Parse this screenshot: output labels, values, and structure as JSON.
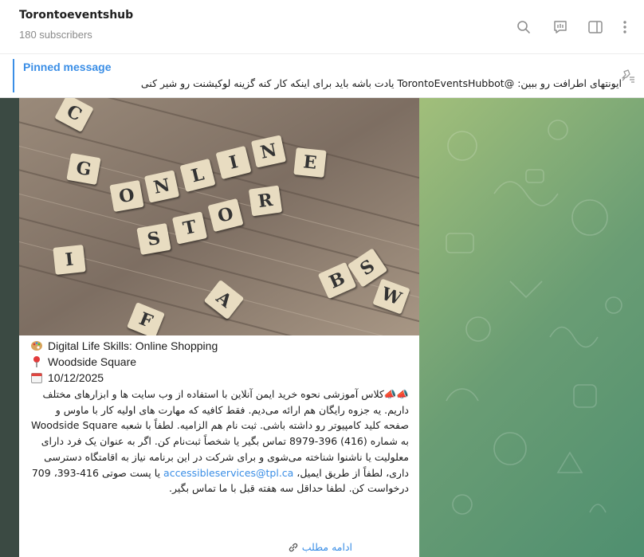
{
  "header": {
    "title": "Torontoeventshub",
    "subscribers": "180 subscribers",
    "icons": [
      "search-icon",
      "live-chat-icon",
      "sidebar-toggle-icon",
      "more-vertical-icon"
    ]
  },
  "pinned": {
    "title": "Pinned message",
    "text": "ایونتهای اطرافت رو ببین: @TorontoEventsHubbot یادت باشه باید برای اینکه کار کنه گزینه لوکیشنت رو شیر کنی",
    "icon": "pin-list-icon"
  },
  "post": {
    "image_tiles": [
      "C",
      "G",
      "O",
      "N",
      "L",
      "I",
      "N",
      "E",
      "S",
      "T",
      "O",
      "R",
      "B",
      "S",
      "W",
      "I",
      "A",
      "F"
    ],
    "event_title": "Digital Life Skills: Online Shopping",
    "location": "Woodside Square",
    "date": "10/12/2025",
    "body_prefix": "📣📣کلاس آموزشی نحوه خرید ایمن آنلاین با استفاده از وب سایت ها و ابزارهای مختلف داریم. یه جزوه رایگان هم ارائه می‌دیم. فقط کافیه که مهارت های اولیه کار با ماوس و صفحه کلید کامپیوتر رو داشته باشی. ثبت نام هم الزامیه. لطفاً با شعبه Woodside Square به شماره (416) 396-8979 تماس بگیر یا شخصاً ثبت‌نام کن. اگر به عنوان یک فرد دارای معلولیت یا ناشنوا شناخته می‌شوی و برای شرکت در این برنامه نیاز به اقامتگاه دسترسی داری، لطفاً از طریق ایمیل، ",
    "email": "accessibleservices@tpl.ca",
    "body_suffix": " یا پست صوتی 416-393، 709 درخواست کن. لطفا حداقل سه هفته قبل با ما تماس بگیر.",
    "read_more": "ادامه مطلب"
  },
  "colors": {
    "accent": "#3a8ee6",
    "chat_bg_start": "#8bb27a",
    "chat_bg_end": "#4f8f70"
  }
}
